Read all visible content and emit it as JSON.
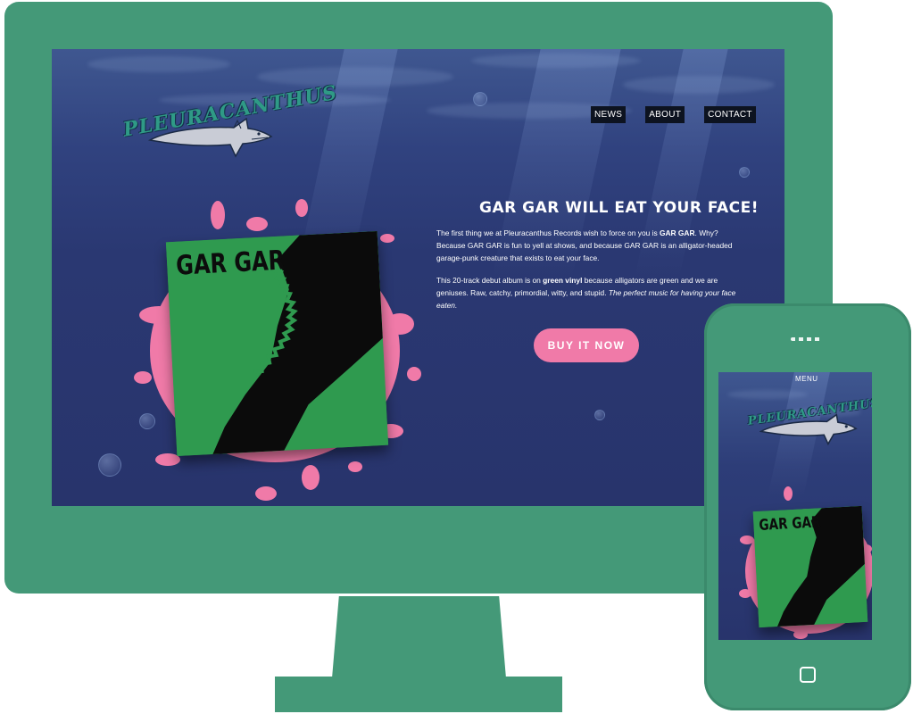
{
  "brand": {
    "logo_text": "PLEURACANTHUS"
  },
  "nav": {
    "items": [
      "NEWS",
      "ABOUT",
      "CONTACT"
    ]
  },
  "hero": {
    "headline": "GAR GAR WILL EAT YOUR FACE!",
    "p1_start": "The first thing we at Pleuracanthus Records wish to force on you is ",
    "p1_bold": "GAR GAR",
    "p1_end": ". Why? Because GAR GAR is fun to yell at shows, and because GAR GAR is an alligator-headed garage-punk creature that exists to eat your face.",
    "p2_start": "This 20-track debut album is on ",
    "p2_bold": "green vinyl",
    "p2_mid": " because alligators are green and we are geniuses. Raw, catchy, primordial, witty, and stupid. ",
    "p2_italic": "The perfect music for having your face eaten.",
    "buy_label": "BUY IT NOW"
  },
  "album": {
    "title": "GAR GAR"
  },
  "mobile": {
    "menu_label": "MENU",
    "logo_text": "PLEURACANTHUS",
    "album_title": "GAR GAR"
  },
  "colors": {
    "device_green": "#449978",
    "ocean_blue": "#28346c",
    "splat_pink": "#f07aa8",
    "album_green": "#2f9a4f",
    "nav_bg": "#0d1320"
  }
}
